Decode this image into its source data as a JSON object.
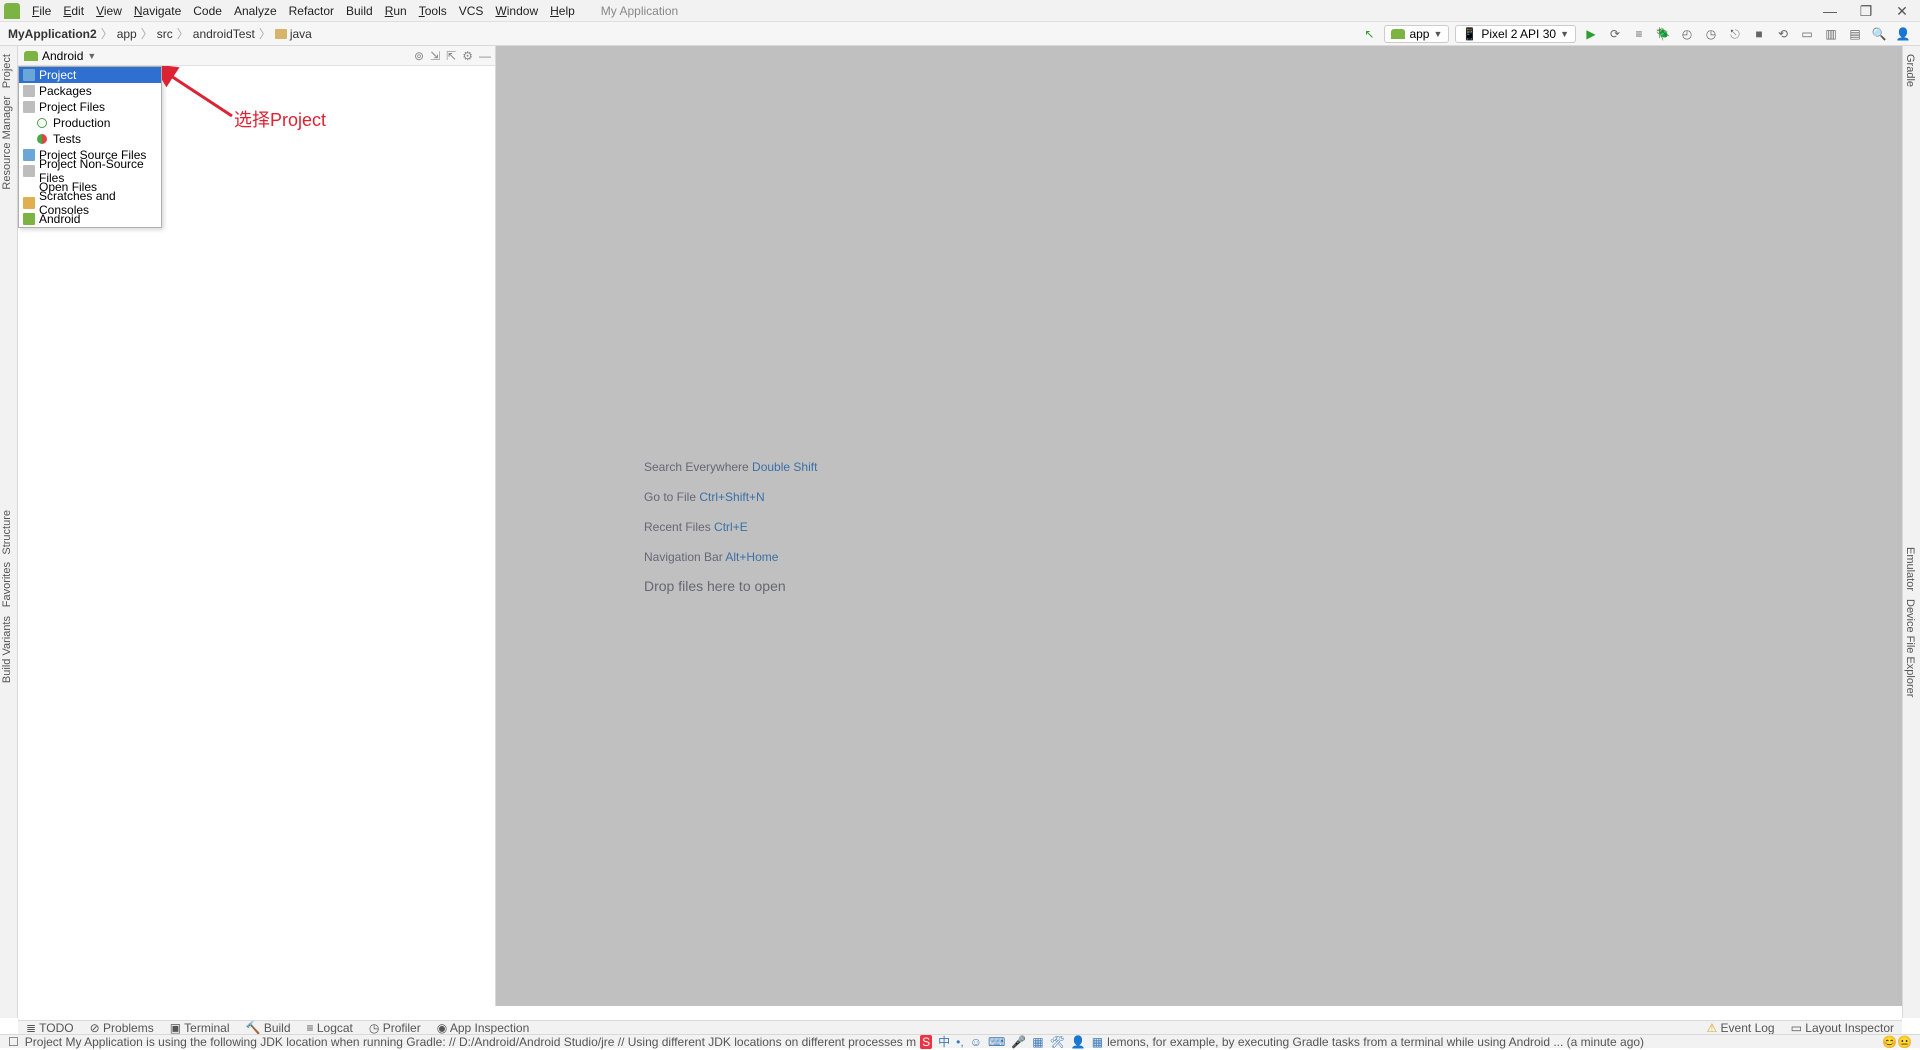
{
  "menu": {
    "file": "File",
    "edit": "Edit",
    "view": "View",
    "navigate": "Navigate",
    "code": "Code",
    "analyze": "Analyze",
    "refactor": "Refactor",
    "build": "Build",
    "run": "Run",
    "tools": "Tools",
    "vcs": "VCS",
    "window": "Window",
    "help": "Help",
    "appname": "My Application"
  },
  "breadcrumb": {
    "root": "MyApplication2",
    "app": "app",
    "src": "src",
    "test": "androidTest",
    "java": "java"
  },
  "run_configs": {
    "app": "app",
    "device": "Pixel 2 API 30"
  },
  "proj_header": {
    "label": "Android"
  },
  "dropdown": {
    "items": [
      {
        "label": "Project"
      },
      {
        "label": "Packages"
      },
      {
        "label": "Project Files"
      },
      {
        "label": "Production"
      },
      {
        "label": "Tests"
      },
      {
        "label": "Project Source Files"
      },
      {
        "label": "Project Non-Source Files"
      },
      {
        "label": "Open Files"
      },
      {
        "label": "Scratches and Consoles"
      },
      {
        "label": "Android"
      }
    ]
  },
  "annotation": {
    "label": "选择Project"
  },
  "editor_hints": {
    "l1a": "Search Everywhere ",
    "l1b": "Double Shift",
    "l2a": "Go to File ",
    "l2b": "Ctrl+Shift+N",
    "l3a": "Recent Files ",
    "l3b": "Ctrl+E",
    "l4a": "Navigation Bar ",
    "l4b": "Alt+Home",
    "l5": "Drop files here to open"
  },
  "left_gutter": {
    "project": "Project",
    "resmgr": "Resource Manager",
    "structure": "Structure",
    "favorites": "Favorites",
    "buildvar": "Build Variants"
  },
  "right_gutter": {
    "gradle": "Gradle",
    "emulator": "Emulator",
    "dfe": "Device File Explorer"
  },
  "toolwin": {
    "todo": "TODO",
    "problems": "Problems",
    "terminal": "Terminal",
    "build": "Build",
    "logcat": "Logcat",
    "profiler": "Profiler",
    "appinsp": "App Inspection",
    "eventlog": "Event Log",
    "layoutinsp": "Layout Inspector"
  },
  "status": {
    "msg_left": "Project My Application is using the following JDK location when running Gradle: // D:/Android/Android Studio/jre // Using different JDK locations on different processes m",
    "msg_right": "lemons, for example, by executing Gradle tasks from a terminal while using Android ... (a minute ago)",
    "ime": "中"
  }
}
